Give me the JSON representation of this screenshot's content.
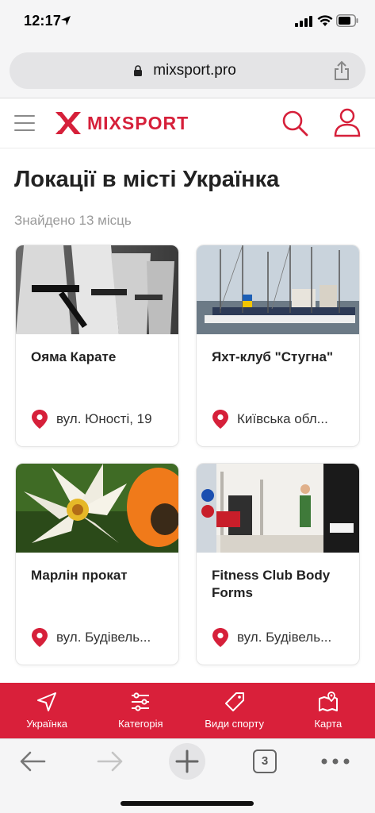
{
  "status_bar": {
    "time": "12:17"
  },
  "browser": {
    "url": "mixsport.pro",
    "open_tabs": "3"
  },
  "header": {
    "logo_text": "MIXSPORT"
  },
  "page": {
    "title": "Локації в місті Українка",
    "found": "Знайдено 13 місць"
  },
  "cards": [
    {
      "title": "Ояма Карате",
      "address": "вул. Юності, 19",
      "image": "karate-photo"
    },
    {
      "title": "Яхт-клуб \"Стугна\"",
      "address": "Київська обл...",
      "image": "yacht-club-photo"
    },
    {
      "title": "Марлін прокат",
      "address": "вул. Будівель...",
      "image": "water-lily-photo"
    },
    {
      "title": "Fitness Club Body Forms",
      "address": "вул. Будівель...",
      "image": "boxing-gym-photo"
    }
  ],
  "bottom_nav": [
    {
      "label": "Українка",
      "icon": "location-arrow-icon"
    },
    {
      "label": "Категорія",
      "icon": "filter-sliders-icon"
    },
    {
      "label": "Види спорту",
      "icon": "tag-icon"
    },
    {
      "label": "Карта",
      "icon": "map-icon"
    }
  ],
  "colors": {
    "brand_red": "#d9203a",
    "logo_red": "#d6203a"
  }
}
